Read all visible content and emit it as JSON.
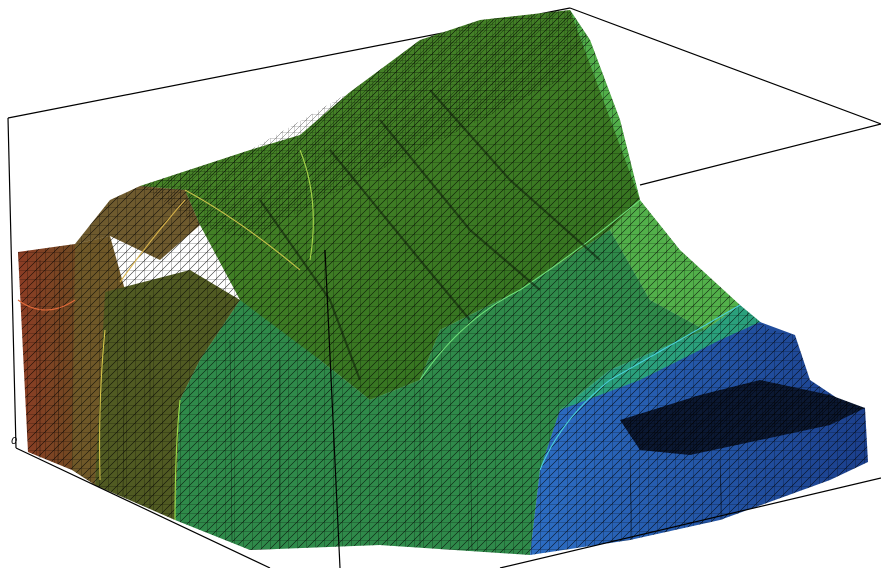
{
  "axis": {
    "origin_label": "0"
  },
  "colors": {
    "background": "#ffffff",
    "bounding_box": "#000000",
    "mesh": "#000000",
    "zone_red": "#8a3a22",
    "zone_orange": "#7a5a2a",
    "zone_olive": "#4f5a22",
    "zone_green": "#3b8a22",
    "zone_light_green": "#5fb84a",
    "zone_teal": "#2b8a5a",
    "zone_cyan": "#2aa58a",
    "zone_blue": "#2a5bb0",
    "zone_dark_blue": "#0a1a3a"
  }
}
